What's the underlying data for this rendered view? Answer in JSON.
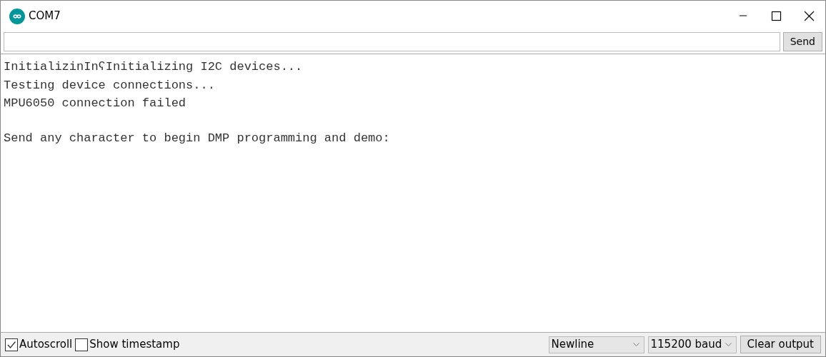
{
  "window": {
    "title": "COM7"
  },
  "input": {
    "button": "Send"
  },
  "output": [
    {
      "text": "InitializinInʕInitializing I2C devices...",
      "gap_before": false
    },
    {
      "text": "Testing device connections...",
      "gap_before": false
    },
    {
      "text": "MPU6050 connection failed",
      "gap_before": false
    },
    {
      "text": "Send any character to begin DMP programming and demo:",
      "gap_before": true
    }
  ],
  "footer": {
    "checkboxes": [
      {
        "label": "Autoscroll",
        "checked": true
      },
      {
        "label": "Show timestamp",
        "checked": false
      }
    ],
    "selects": [
      {
        "value": "Newline"
      },
      {
        "value": "115200 baud"
      }
    ],
    "button": "Clear output"
  }
}
